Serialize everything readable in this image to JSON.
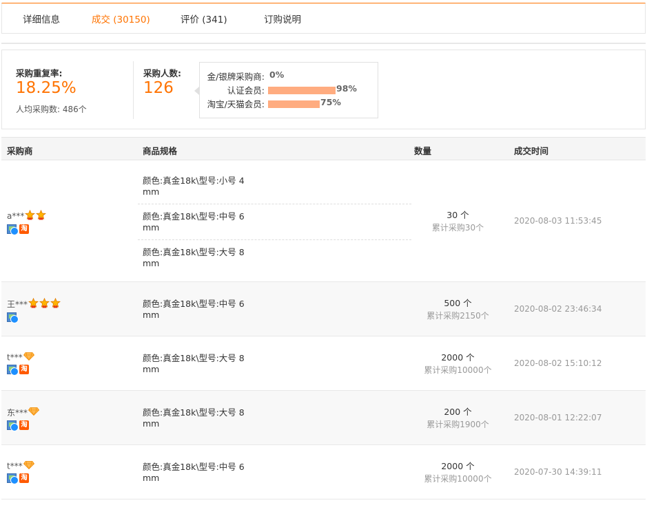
{
  "tabs": [
    {
      "label": "详细信息"
    },
    {
      "label": "成交 (30150)"
    },
    {
      "label": "评价 (341)"
    },
    {
      "label": "订购说明"
    }
  ],
  "stats": {
    "repeat_rate_label": "采购重复率:",
    "repeat_rate_value": "18.25%",
    "avg_purchase": "人均采购数: 486个",
    "buyers_label": "采购人数:",
    "buyers_value": "126",
    "distribution": [
      {
        "label": "金/银牌采购商:",
        "pct": "0%",
        "fraction": 0.0
      },
      {
        "label": "认证会员:",
        "pct": "98%",
        "fraction": 0.98
      },
      {
        "label": "淘宝/天猫会员:",
        "pct": "75%",
        "fraction": 0.75
      }
    ],
    "bar_color": "#ffac80"
  },
  "table": {
    "headers": [
      "采购商",
      "商品规格",
      "数量",
      "成交时间"
    ],
    "rows": [
      {
        "buyer": "a***",
        "medals": [
          "crown-medal",
          "crown-medal"
        ],
        "icons": [
          "member-icon",
          "tao-icon"
        ],
        "specs": [
          "颜色:真金18k\\型号:小号 4mm",
          "颜色:真金18k\\型号:中号 6mm",
          "颜色:真金18k\\型号:大号 8mm"
        ],
        "qty": "30 个",
        "cumulative": "累计采购30个",
        "time": "2020-08-03 11:53:45"
      },
      {
        "buyer": "王***",
        "medals": [
          "crown-medal",
          "crown-medal",
          "crown-medal"
        ],
        "icons": [
          "member-icon"
        ],
        "specs": [
          "颜色:真金18k\\型号:中号 6mm"
        ],
        "qty": "500 个",
        "cumulative": "累计采购2150个",
        "time": "2020-08-02 23:46:34"
      },
      {
        "buyer": "t***",
        "medals": [
          "diamond-medal"
        ],
        "icons": [
          "member-icon",
          "tao-icon"
        ],
        "specs": [
          "颜色:真金18k\\型号:大号 8mm"
        ],
        "qty": "2000 个",
        "cumulative": "累计采购10000个",
        "time": "2020-08-02 15:10:12"
      },
      {
        "buyer": "东***",
        "medals": [
          "diamond-medal"
        ],
        "icons": [
          "member-icon",
          "tao-icon"
        ],
        "specs": [
          "颜色:真金18k\\型号:大号 8mm"
        ],
        "qty": "200 个",
        "cumulative": "累计采购1900个",
        "time": "2020-08-01 12:22:07"
      },
      {
        "buyer": "t***",
        "medals": [
          "diamond-medal"
        ],
        "icons": [
          "member-icon",
          "tao-icon"
        ],
        "specs": [
          "颜色:真金18k\\型号:中号 6mm"
        ],
        "qty": "2000 个",
        "cumulative": "累计采购10000个",
        "time": "2020-07-30 14:39:11"
      }
    ]
  },
  "tao_glyph": "淘",
  "accent_color": "#ff7300"
}
